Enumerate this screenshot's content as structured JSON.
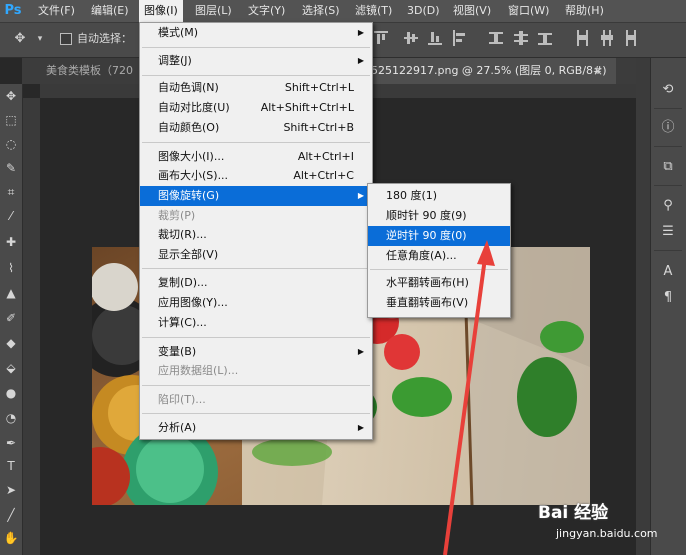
{
  "menubar": {
    "logo": "Ps",
    "items": [
      "文件(F)",
      "编辑(E)",
      "图像(I)",
      "图层(L)",
      "文字(Y)",
      "选择(S)",
      "滤镜(T)",
      "3D(D)",
      "视图(V)",
      "窗口(W)",
      "帮助(H)"
    ]
  },
  "options": {
    "auto_select_label": "自动选择："
  },
  "tabs": {
    "inactive": "美食类模板（720",
    "active": "525122917.png @ 27.5% (图层 0, RGB/8#)",
    "close": "×"
  },
  "image_menu": {
    "items": [
      {
        "label": "模式(M)",
        "shortcut": "",
        "submenu": true,
        "disabled": false
      },
      {
        "label": "调整(J)",
        "shortcut": "",
        "submenu": true,
        "disabled": false
      },
      {
        "label": "自动色调(N)",
        "shortcut": "Shift+Ctrl+L",
        "submenu": false,
        "disabled": false
      },
      {
        "label": "自动对比度(U)",
        "shortcut": "Alt+Shift+Ctrl+L",
        "submenu": false,
        "disabled": false
      },
      {
        "label": "自动颜色(O)",
        "shortcut": "Shift+Ctrl+B",
        "submenu": false,
        "disabled": false
      },
      {
        "label": "图像大小(I)...",
        "shortcut": "Alt+Ctrl+I",
        "submenu": false,
        "disabled": false
      },
      {
        "label": "画布大小(S)...",
        "shortcut": "Alt+Ctrl+C",
        "submenu": false,
        "disabled": false
      },
      {
        "label": "图像旋转(G)",
        "shortcut": "",
        "submenu": true,
        "disabled": false,
        "highlighted": true
      },
      {
        "label": "裁剪(P)",
        "shortcut": "",
        "submenu": false,
        "disabled": true
      },
      {
        "label": "裁切(R)...",
        "shortcut": "",
        "submenu": false,
        "disabled": false
      },
      {
        "label": "显示全部(V)",
        "shortcut": "",
        "submenu": false,
        "disabled": false
      },
      {
        "label": "复制(D)...",
        "shortcut": "",
        "submenu": false,
        "disabled": false
      },
      {
        "label": "应用图像(Y)...",
        "shortcut": "",
        "submenu": false,
        "disabled": false
      },
      {
        "label": "计算(C)...",
        "shortcut": "",
        "submenu": false,
        "disabled": false
      },
      {
        "label": "变量(B)",
        "shortcut": "",
        "submenu": true,
        "disabled": false
      },
      {
        "label": "应用数据组(L)...",
        "shortcut": "",
        "submenu": false,
        "disabled": true
      },
      {
        "label": "陷印(T)...",
        "shortcut": "",
        "submenu": false,
        "disabled": true
      },
      {
        "label": "分析(A)",
        "shortcut": "",
        "submenu": true,
        "disabled": false
      }
    ]
  },
  "rotation_submenu": {
    "items": [
      {
        "label": "180 度(1)"
      },
      {
        "label": "顺时针 90 度(9)"
      },
      {
        "label": "逆时针 90 度(0)",
        "highlighted": true
      },
      {
        "label": "任意角度(A)..."
      },
      {
        "label": "水平翻转画布(H)"
      },
      {
        "label": "垂直翻转画布(V)"
      }
    ]
  },
  "watermark": {
    "brand": "Bai 经验",
    "url": "jingyan.baidu.com"
  },
  "colors": {
    "menu_highlight": "#0a6dd8",
    "arrow": "#e8403a",
    "ps_blue": "#31a8ff"
  }
}
